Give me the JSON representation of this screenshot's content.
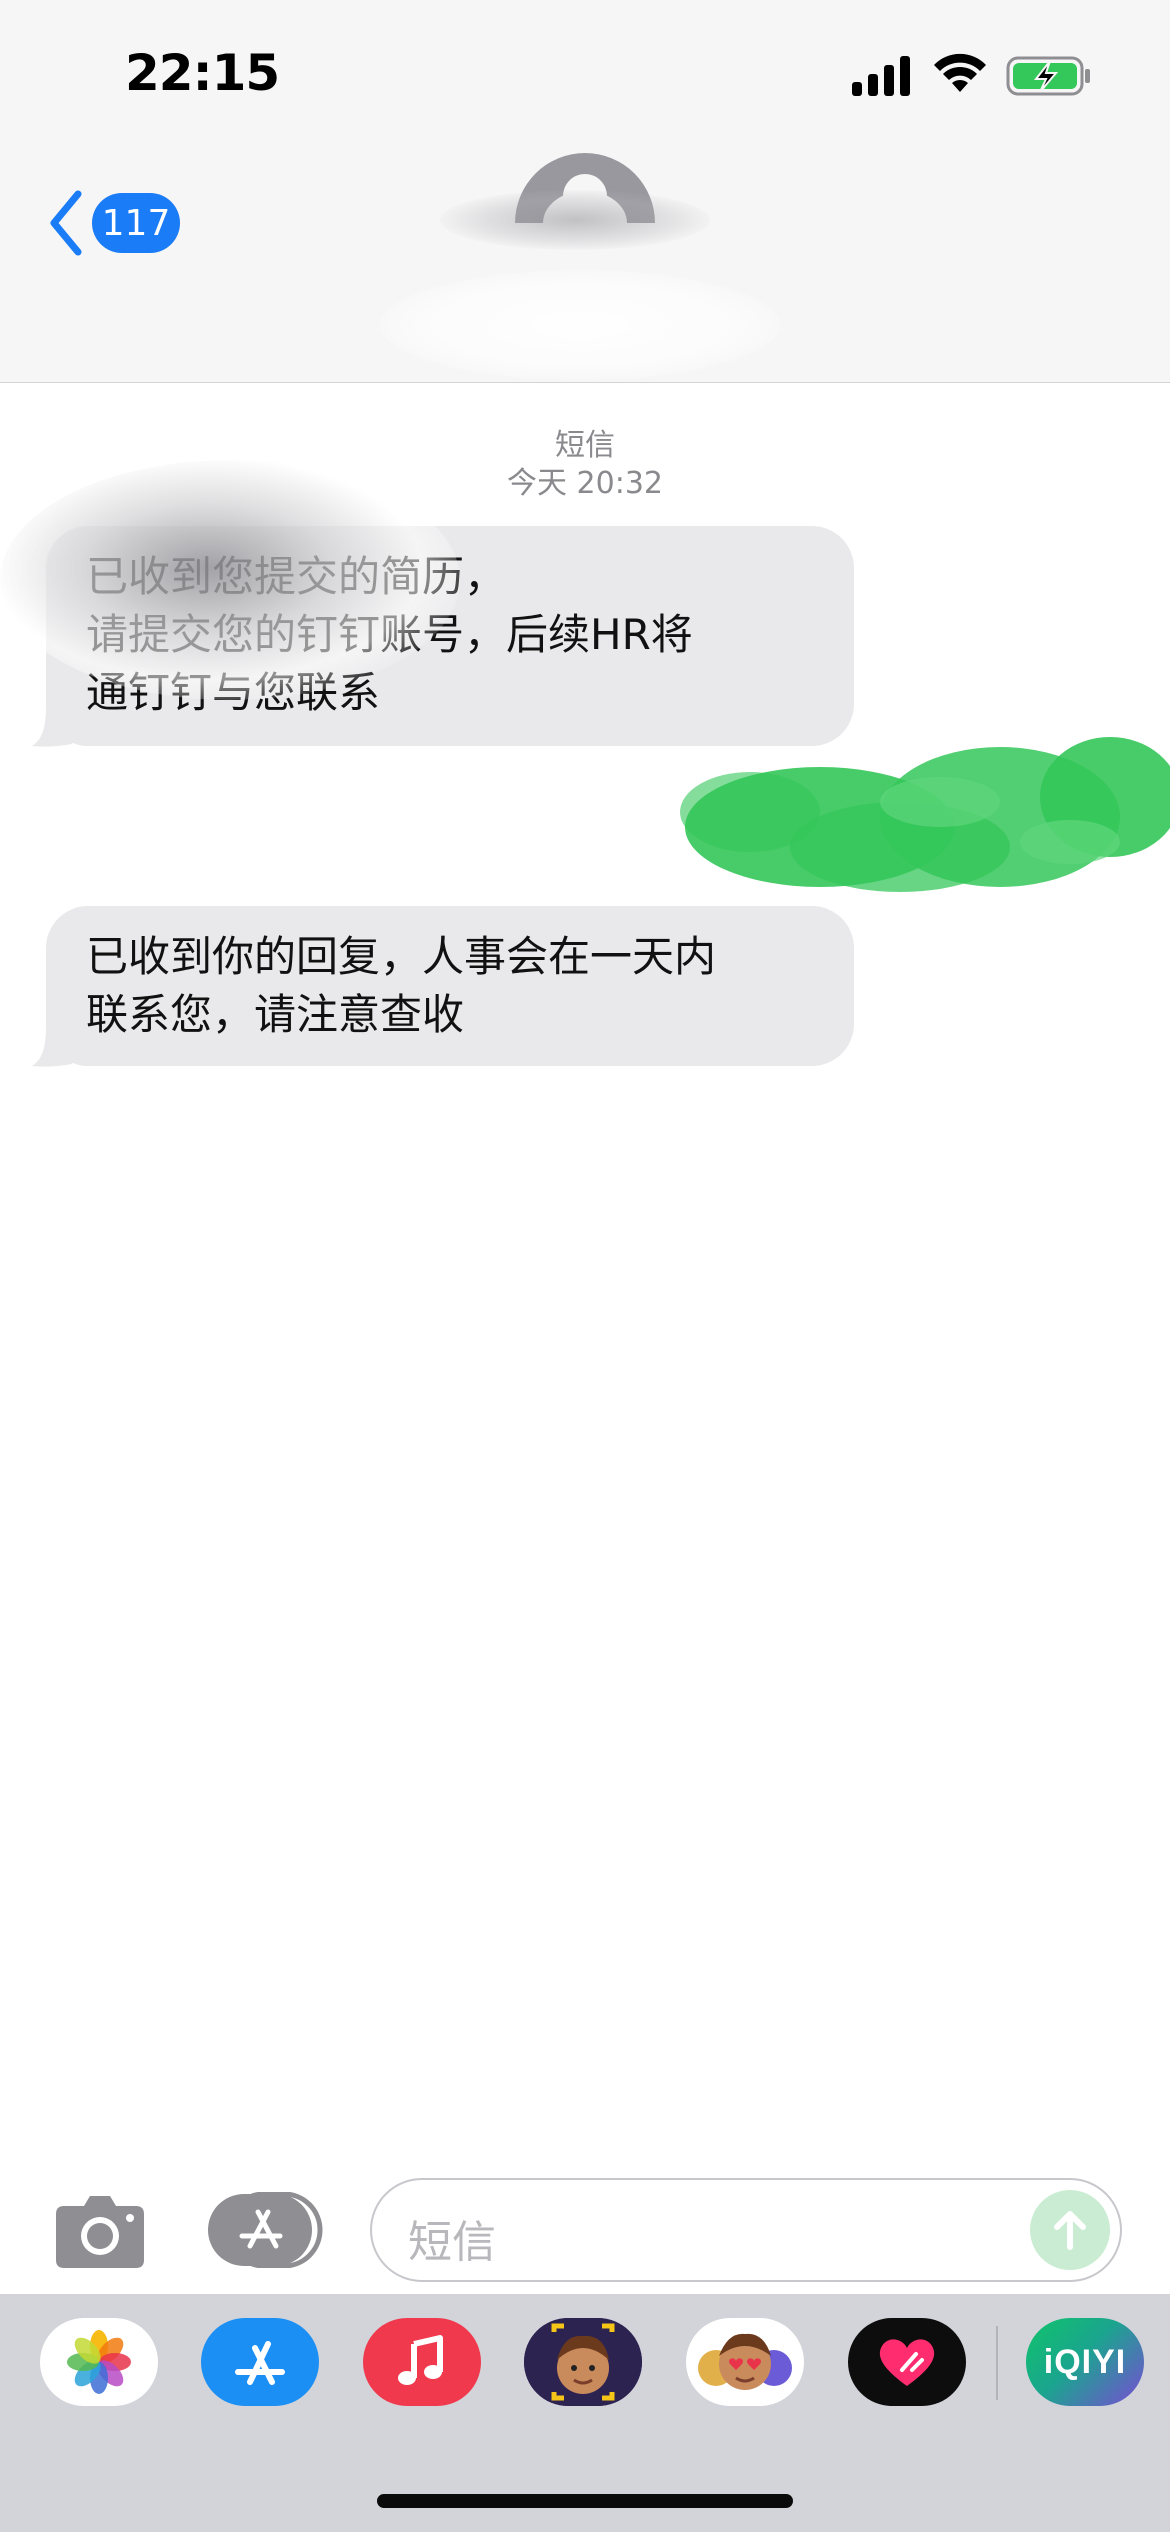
{
  "status_bar": {
    "time": "22:15"
  },
  "nav": {
    "back_count": "117"
  },
  "conversation": {
    "service_label": "短信",
    "timestamp": "今天 20:32",
    "messages": [
      {
        "text": "已收到您提交的简历，\n请提交您的钉钉账号，后续HR将\n通钉钉与您联系"
      },
      {
        "text": "已收到你的回复，人事会在一天内\n联系您，请注意查收"
      }
    ]
  },
  "input": {
    "placeholder": "短信"
  },
  "app_drawer": {
    "apps": [
      {
        "icon": "photos-icon"
      },
      {
        "icon": "app-store-icon"
      },
      {
        "icon": "music-icon"
      },
      {
        "icon": "memoji-icon"
      },
      {
        "icon": "memoji-stickers-icon"
      },
      {
        "icon": "digital-touch-icon"
      },
      {
        "icon": "iqiyi-icon",
        "label": "iQIYI"
      }
    ]
  },
  "colors": {
    "accent": "#1a7cf6",
    "bubble_received": "#e9e9eb",
    "send_button": "#c9ecd2",
    "scribble": "#34c759"
  }
}
